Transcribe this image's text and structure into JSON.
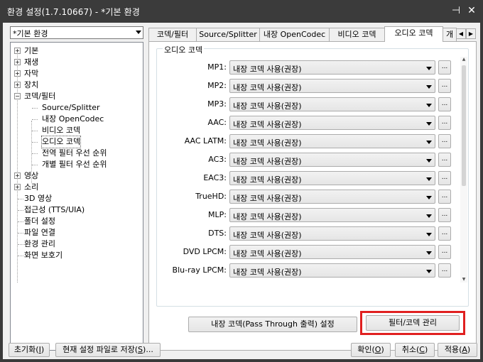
{
  "window": {
    "title": "환경 설정(1.7.10667) - *기본 환경",
    "pin_glyph": "⊣",
    "close_glyph": "✕"
  },
  "profile": {
    "selected": "*기본 환경"
  },
  "tree": {
    "items": [
      {
        "label": "기본",
        "expander": "+"
      },
      {
        "label": "재생",
        "expander": "+"
      },
      {
        "label": "자막",
        "expander": "+"
      },
      {
        "label": "장치",
        "expander": "+"
      },
      {
        "label": "코덱/필터",
        "expander": "−"
      },
      {
        "label": "Source/Splitter"
      },
      {
        "label": "내장 OpenCodec"
      },
      {
        "label": "비디오 코덱"
      },
      {
        "label": "오디오 코덱"
      },
      {
        "label": "전역 필터 우선 순위"
      },
      {
        "label": "개별 필터 우선 순위"
      },
      {
        "label": "영상",
        "expander": "+"
      },
      {
        "label": "소리",
        "expander": "+"
      },
      {
        "label": "3D 영상"
      },
      {
        "label": "접근성 (TTS/UIA)"
      },
      {
        "label": "폴더 설정"
      },
      {
        "label": "파일 연결"
      },
      {
        "label": "환경 관리"
      },
      {
        "label": "화면 보호기"
      }
    ]
  },
  "tabs": [
    {
      "label": "코덱/필터"
    },
    {
      "label": "Source/Splitter"
    },
    {
      "label": "내장 OpenCodec"
    },
    {
      "label": "비디오 코덱"
    },
    {
      "label": "오디오 코덱"
    },
    {
      "label": "개"
    }
  ],
  "tab_scroll": {
    "left": "◀",
    "right": "▶"
  },
  "group": {
    "title": "오디오 코덱",
    "rows": [
      {
        "name": "MP1:",
        "value": "내장 코덱 사용(권장)"
      },
      {
        "name": "MP2:",
        "value": "내장 코덱 사용(권장)"
      },
      {
        "name": "MP3:",
        "value": "내장 코덱 사용(권장)"
      },
      {
        "name": "AAC:",
        "value": "내장 코덱 사용(권장)"
      },
      {
        "name": "AAC LATM:",
        "value": "내장 코덱 사용(권장)"
      },
      {
        "name": "AC3:",
        "value": "내장 코덱 사용(권장)"
      },
      {
        "name": "EAC3:",
        "value": "내장 코덱 사용(권장)"
      },
      {
        "name": "TrueHD:",
        "value": "내장 코덱 사용(권장)"
      },
      {
        "name": "MLP:",
        "value": "내장 코덱 사용(권장)"
      },
      {
        "name": "DTS:",
        "value": "내장 코덱 사용(권장)"
      },
      {
        "name": "DVD LPCM:",
        "value": "내장 코덱 사용(권장)"
      },
      {
        "name": "Blu-ray LPCM:",
        "value": "내장 코덱 사용(권장)"
      }
    ],
    "more_label": "..."
  },
  "passthrough_button": "내장 코덱(Pass Through 출력) 설정",
  "filter_manage_button": "필터/코덱 관리",
  "highlight_color": "#e02020",
  "bottom": {
    "reset": {
      "text": "초기화",
      "key": "I"
    },
    "save_preset": {
      "text": "현재 설정 파일로 저장",
      "key": "S",
      "suffix": "..."
    },
    "ok": {
      "text": "확인",
      "key": "O"
    },
    "cancel": {
      "text": "취소",
      "key": "C"
    },
    "apply": {
      "text": "적용",
      "key": "A"
    }
  }
}
